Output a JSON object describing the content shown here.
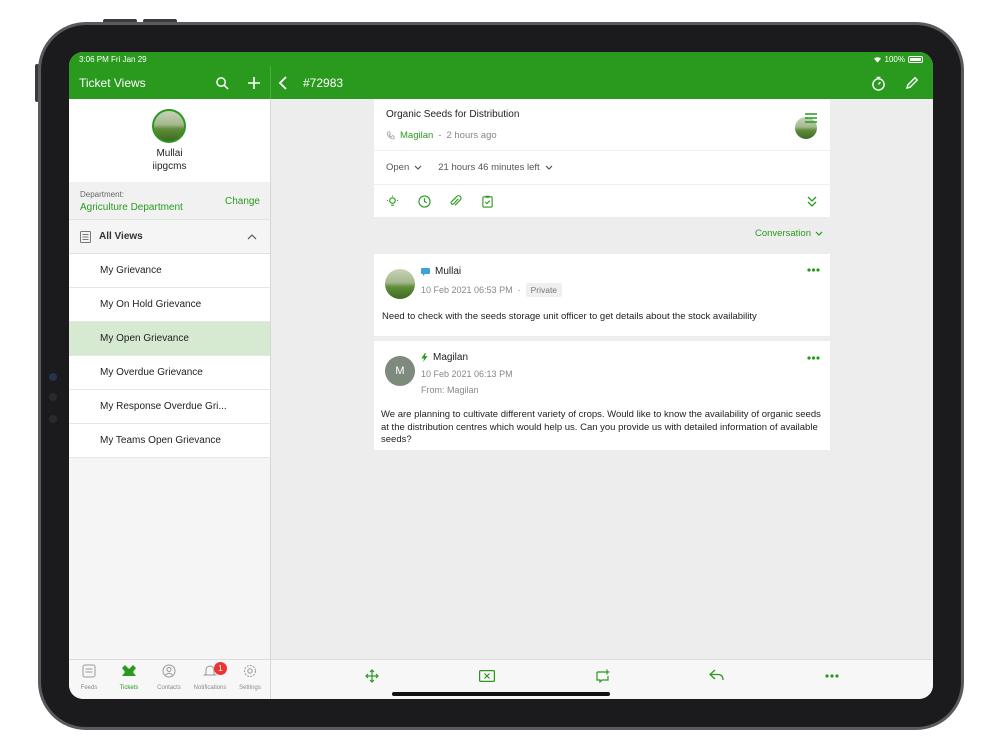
{
  "status_bar": {
    "time": "3:06 PM   Fri Jan 29",
    "battery": "100%"
  },
  "left_header": {
    "title": "Ticket Views"
  },
  "profile": {
    "name": "Mullai",
    "org": "iipgcms"
  },
  "department": {
    "label": "Department:",
    "value": "Agriculture Department",
    "change_label": "Change"
  },
  "views": {
    "header": "All Views",
    "items": [
      {
        "label": "My Grievance"
      },
      {
        "label": "My On Hold Grievance"
      },
      {
        "label": "My Open Grievance"
      },
      {
        "label": "My Overdue Grievance"
      },
      {
        "label": "My Response Overdue Gri..."
      },
      {
        "label": "My Teams Open Grievance"
      }
    ],
    "active_index": 2
  },
  "tabs": [
    {
      "label": "Feeds",
      "icon": "feeds-icon"
    },
    {
      "label": "Tickets",
      "icon": "tickets-icon"
    },
    {
      "label": "Contacts",
      "icon": "contacts-icon"
    },
    {
      "label": "Notifications",
      "icon": "bell-icon",
      "badge": "1"
    },
    {
      "label": "Settings",
      "icon": "gear-icon"
    }
  ],
  "ticket": {
    "number": "#72983",
    "subject": "Organic Seeds for Distribution",
    "contact": "Magilan",
    "time_ago": "2 hours ago",
    "status": "Open",
    "due": "21 hours 46 minutes left"
  },
  "conversation_label": "Conversation",
  "messages": [
    {
      "author": "Mullai",
      "date": "10 Feb 2021 06:53 PM",
      "tag": "Private",
      "body": "Need to check with the seeds storage unit officer to get details about the stock availability"
    },
    {
      "author": "Magilan",
      "avatar_letter": "M",
      "date": "10 Feb 2021 06:13 PM",
      "from": "From: Magilan",
      "body": "We are planning to cultivate different variety of crops. Would like to know the availability of organic seeds at the distribution centres which would help us. Can you provide us with detailed information of available seeds?"
    }
  ],
  "colors": {
    "brand": "#2a9a1f",
    "active_row": "#d6ead2"
  }
}
